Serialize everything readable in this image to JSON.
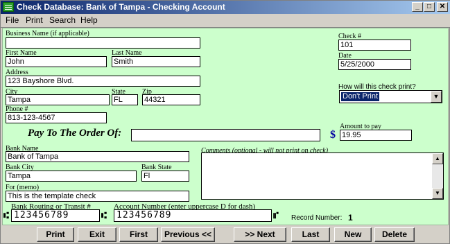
{
  "window": {
    "title": "Check Database: Bank of Tampa - Checking Account",
    "minimize": "_",
    "maximize": "□",
    "close": "✕"
  },
  "menu": [
    "File",
    "Print",
    "Search",
    "Help"
  ],
  "labels": {
    "business_name": "Business Name (if applicable)",
    "first_name": "First Name",
    "last_name": "Last Name",
    "address": "Address",
    "city": "City",
    "state": "State",
    "zip": "Zip",
    "phone": "Phone #",
    "check_number": "Check #",
    "date": "Date",
    "print_question": "How will this check print?",
    "pay_to": "Pay To The Order Of:",
    "amount": "Amount to pay",
    "bank_name": "Bank Name",
    "bank_city": "Bank City",
    "bank_state": "Bank State",
    "memo": "For (memo)",
    "comments": "Comments (optional - will not print on check)",
    "routing": "Bank Routing or Transit #",
    "account": "Account Number (enter uppercase D for dash)",
    "record_number": "Record Number:"
  },
  "values": {
    "business_name": "",
    "first_name": "John",
    "last_name": "Smith",
    "address": "123 Bayshore Blvd.",
    "city": "Tampa",
    "state": "FL",
    "zip": "44321",
    "phone": "813-123-4567",
    "check_number": "101",
    "date": "5/25/2000",
    "print_option": "Don't Print",
    "pay_to": "",
    "currency_symbol": "$",
    "amount": "19.95",
    "bank_name": "Bank of Tampa",
    "bank_city": "Tampa",
    "bank_state": "Fl",
    "memo": "This is the template check",
    "comments": "",
    "routing": "123456789",
    "account": "123456789",
    "record_number": "1"
  },
  "micr": {
    "transit_symbol": "⑆",
    "onus_symbol": "⑈"
  },
  "scroll": {
    "up": "▲",
    "down": "▼"
  },
  "dropdown_arrow": "▼",
  "buttons": {
    "print": "Print",
    "exit": "Exit",
    "first": "First",
    "previous": "Previous <<",
    "next": ">>  Next",
    "last": "Last",
    "new": "New",
    "delete": "Delete"
  },
  "colors": {
    "panel_bg": "#ccffcc",
    "title_bar": "#0a246a",
    "selection": "#0a246a",
    "dollar": "#0000a0"
  },
  "icons": {
    "app": "check-database-icon",
    "dropdown": "chevron-down-icon"
  }
}
